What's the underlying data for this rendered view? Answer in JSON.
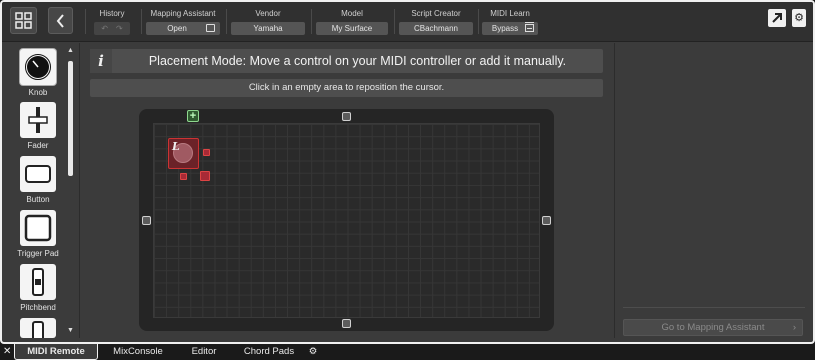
{
  "toolbar": {
    "history": {
      "label": "History",
      "undo_icon": "undo-icon",
      "redo_icon": "redo-icon"
    },
    "mapping_assistant": {
      "label": "Mapping Assistant",
      "value": "Open"
    },
    "vendor": {
      "label": "Vendor",
      "value": "Yamaha"
    },
    "model": {
      "label": "Model",
      "value": "My Surface"
    },
    "script_creator": {
      "label": "Script Creator",
      "value": "CBachmann"
    },
    "midi_learn": {
      "label": "MIDI Learn",
      "value": "Bypass"
    }
  },
  "palette": {
    "items": [
      {
        "label": "Knob",
        "icon": "knob-icon"
      },
      {
        "label": "Fader",
        "icon": "fader-icon"
      },
      {
        "label": "Button",
        "icon": "button-icon"
      },
      {
        "label": "Trigger Pad",
        "icon": "trigger-pad-icon"
      },
      {
        "label": "Pitchbend",
        "icon": "pitchbend-icon"
      }
    ]
  },
  "main": {
    "info_icon": "i",
    "placement_message": "Placement Mode: Move a control on your MIDI controller or add it manually.",
    "hint": "Click in an empty area to reposition the cursor.",
    "knob_letter": "L"
  },
  "right_panel": {
    "goto_label": "Go to Mapping Assistant"
  },
  "bottom_tabs": [
    {
      "label": "MIDI Remote",
      "active": true
    },
    {
      "label": "MixConsole",
      "active": false
    },
    {
      "label": "Editor",
      "active": false
    },
    {
      "label": "Chord Pads",
      "active": false
    }
  ],
  "colors": {
    "selection_red": "#c33",
    "add_green": "#8fd88f",
    "panel_bg": "#3b3b3b"
  }
}
